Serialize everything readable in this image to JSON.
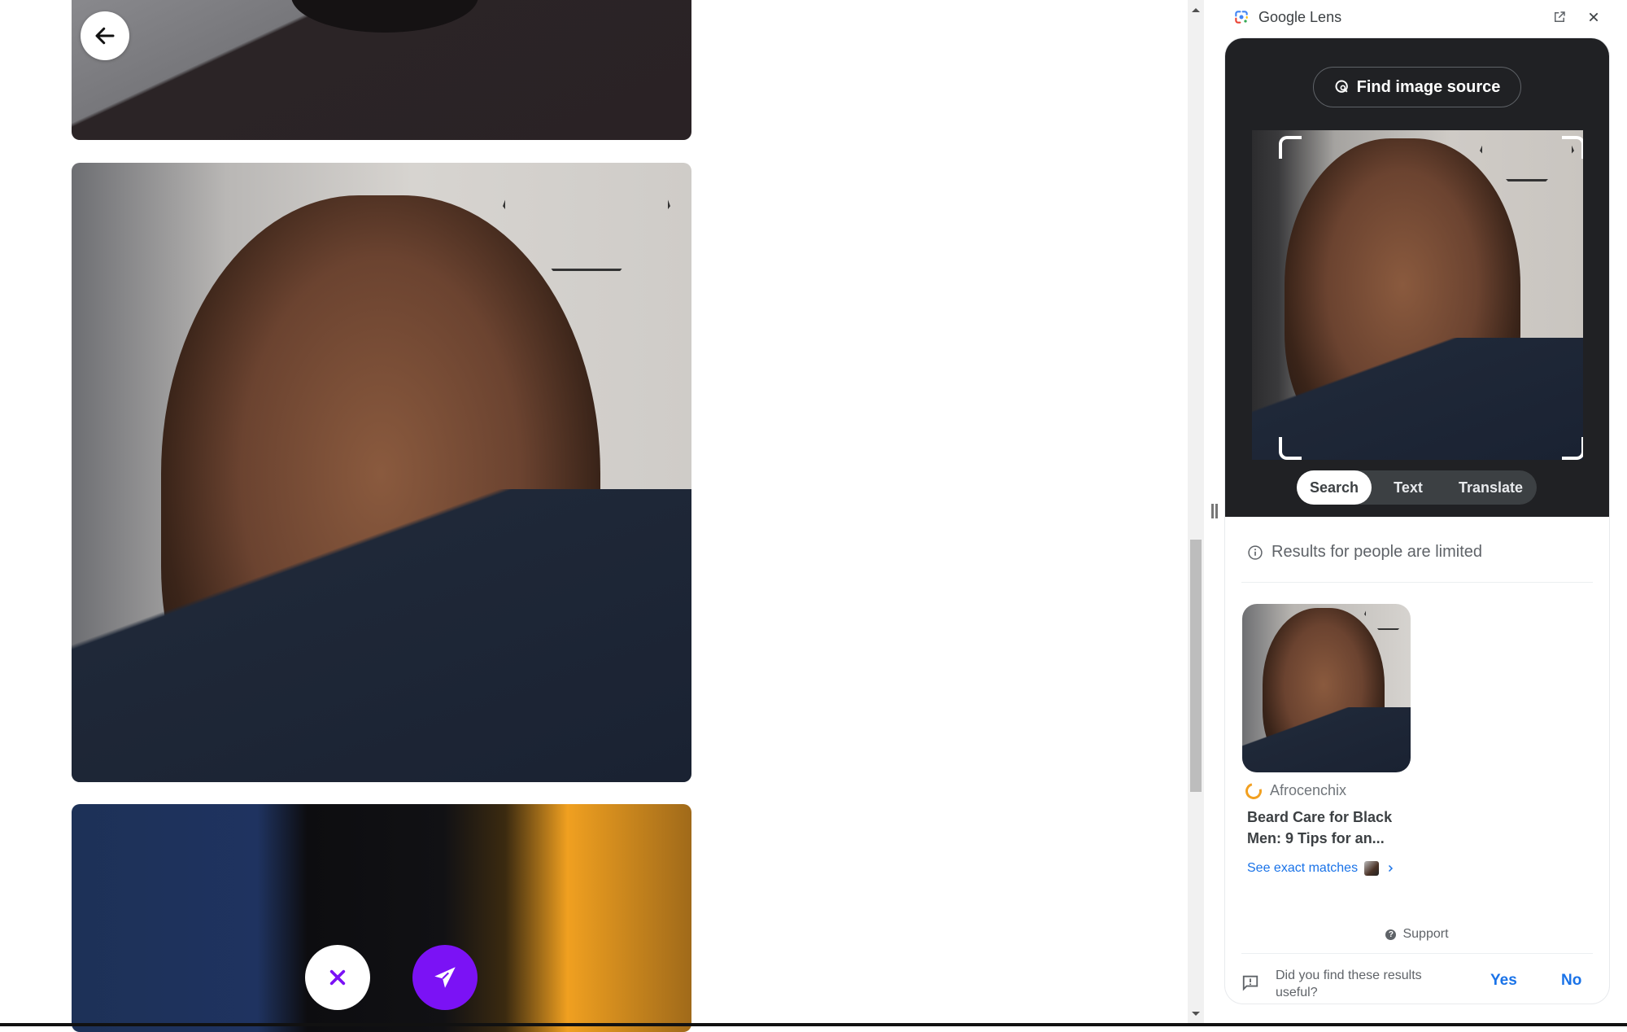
{
  "page": {
    "back_button_label": "Back",
    "photos": [
      {
        "alt": "Profile photo 1 (cropped, top)"
      },
      {
        "alt": "Profile photo 2 - selfie of bearded man"
      },
      {
        "alt": "Profile photo 3 (dim, partially visible)"
      }
    ],
    "actions": {
      "reject_label": "Reject",
      "send_label": "Send"
    },
    "accent_color": "#7b12f5"
  },
  "lens": {
    "title": "Google Lens",
    "open_new_tab_label": "Open in new tab",
    "close_label": "Close",
    "find_source_label": "Find image source",
    "tabs": [
      {
        "label": "Search",
        "active": true
      },
      {
        "label": "Text",
        "active": false
      },
      {
        "label": "Translate",
        "active": false
      }
    ],
    "notice": "Results for people are limited",
    "result": {
      "source": "Afrocenchix",
      "title": "Beard Care for Black Men: 9 Tips for an...",
      "title_line1": "Beard Care for Black",
      "title_line2": "Men: 9 Tips for an...",
      "exact_matches_label": "See exact matches"
    },
    "support_label": "Support",
    "feedback": {
      "question": "Did you find these results useful?",
      "yes_label": "Yes",
      "no_label": "No"
    },
    "link_color": "#1a73e8"
  }
}
